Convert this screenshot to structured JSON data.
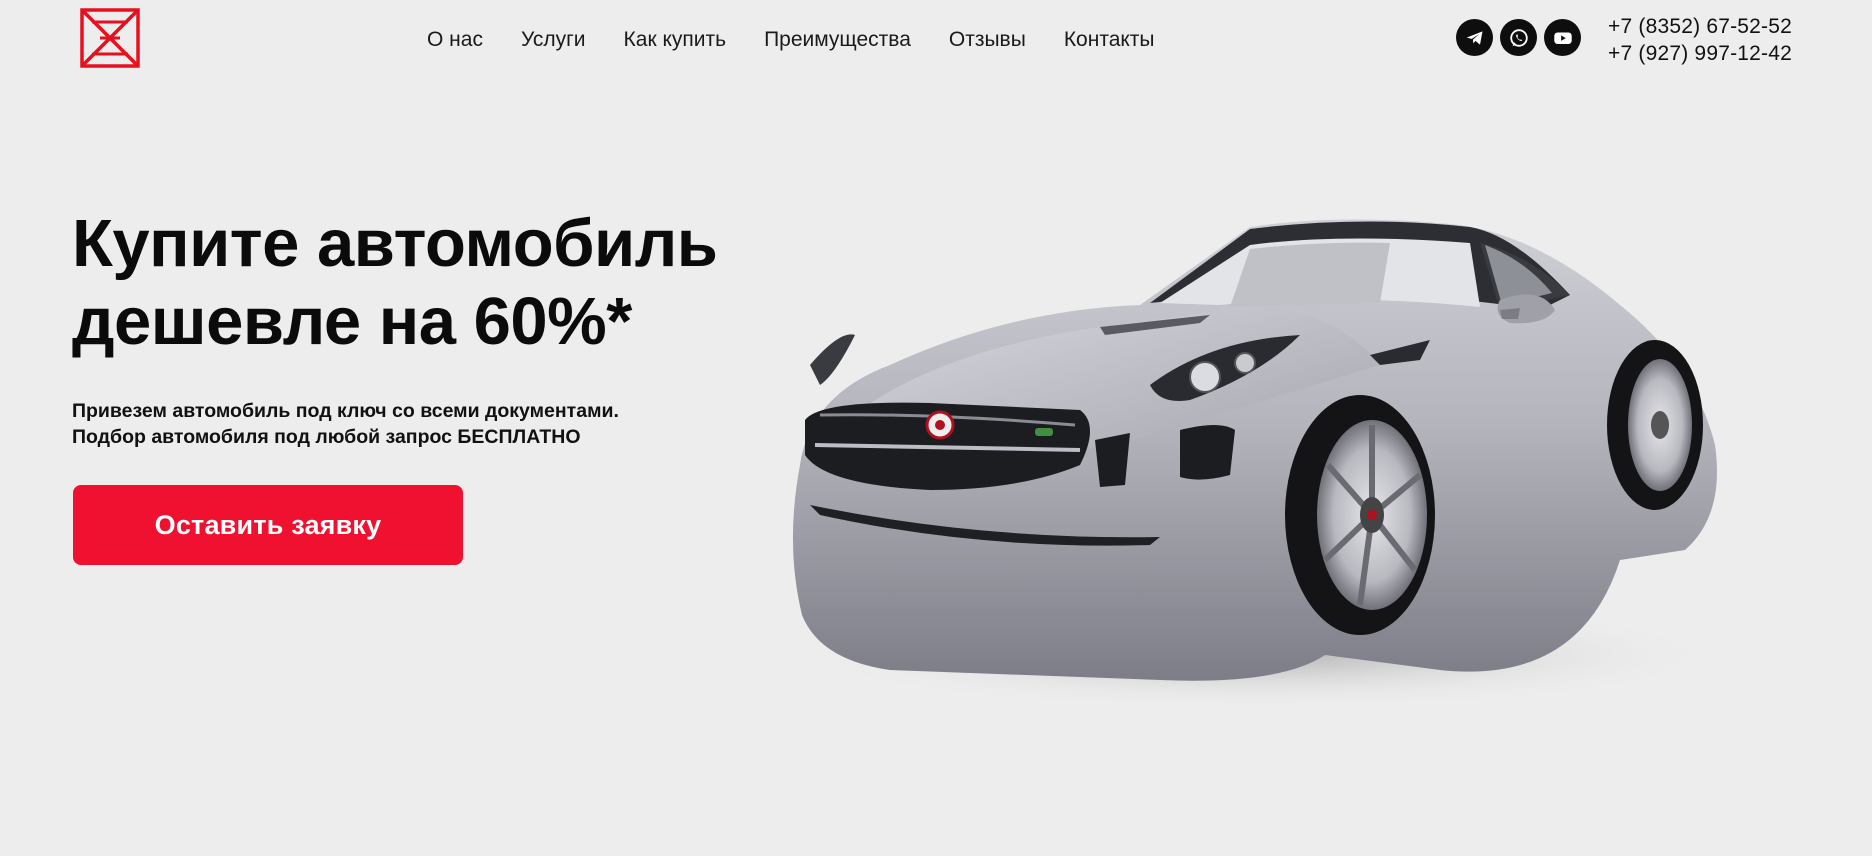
{
  "header": {
    "logo_name": "red-hourglass-logo",
    "nav": [
      {
        "label": "О нас"
      },
      {
        "label": "Услуги"
      },
      {
        "label": "Как купить"
      },
      {
        "label": "Преимущества"
      },
      {
        "label": "Отзывы"
      },
      {
        "label": "Контакты"
      }
    ],
    "socials": [
      {
        "icon": "telegram-icon"
      },
      {
        "icon": "whatsapp-icon"
      },
      {
        "icon": "youtube-icon"
      }
    ],
    "phones": [
      "+7 (8352) 67-52-52",
      "+7 (927) 997-12-42"
    ]
  },
  "hero": {
    "title_lines": [
      "Купите автомобиль",
      "дешевле на 60%*"
    ],
    "subtitle_lines": [
      "Привезем автомобиль под ключ со всеми документами.",
      "Подбор автомобиля под любой запрос БЕСПЛАТНО"
    ],
    "cta_label": "Оставить заявку",
    "image": "silver-sports-coupe"
  },
  "colors": {
    "background": "#ededed",
    "accent": "#f0102f",
    "logo": "#e8101e",
    "icon_bg": "#0e0e0e"
  }
}
